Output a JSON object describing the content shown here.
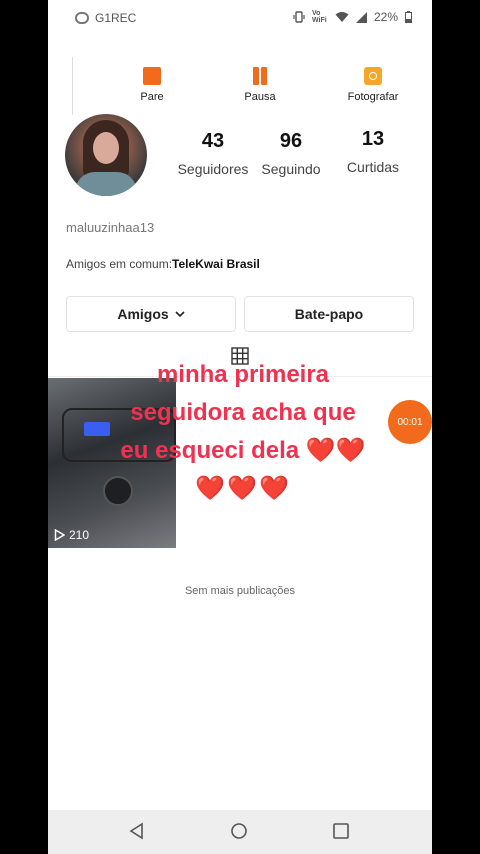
{
  "status_bar": {
    "app_name": "G1REC",
    "network_label": "Vo WiFi",
    "battery": "22%"
  },
  "recorder_toolbar": {
    "stop_label": "Pare",
    "pause_label": "Pausa",
    "photo_label": "Fotografar"
  },
  "profile": {
    "followers_count": "43",
    "followers_label": "Seguidores",
    "following_count": "96",
    "following_label": "Seguindo",
    "likes_count": "13",
    "likes_label": "Curtidas",
    "username": "maluuzinhaa13",
    "mutual_prefix": "Amigos em comum:",
    "mutual_name": "TeleKwai Brasil"
  },
  "actions": {
    "friends_label": "Amigos",
    "chat_label": "Bate-papo"
  },
  "post": {
    "plays": "210",
    "overlay_lines": [
      "minha primeira",
      "seguidora acha que",
      "eu esqueci dela ❤️❤️",
      "❤️❤️❤️"
    ]
  },
  "recording_timer": "00:01",
  "no_more_posts": "Sem mais publicações",
  "colors": {
    "accent": "#f26b1d",
    "overlay_text": "#f0314f"
  }
}
